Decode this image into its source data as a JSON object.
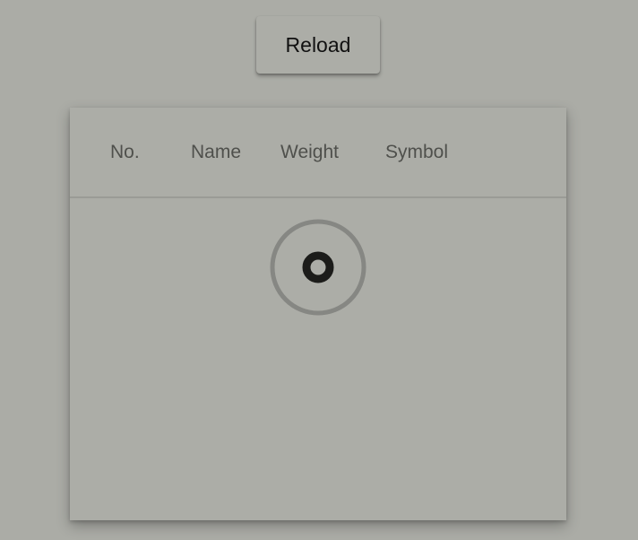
{
  "toolbar": {
    "reload_label": "Reload"
  },
  "table": {
    "columns": [
      "No.",
      "Name",
      "Weight",
      "Symbol"
    ],
    "rows": [],
    "loading": true
  },
  "colors": {
    "background": "#abaca6",
    "header_text": "#4f504c",
    "spinner_track": "#868783",
    "spinner_core": "#1c1c1a"
  },
  "icons": {
    "spinner": "loading-spinner-icon"
  }
}
